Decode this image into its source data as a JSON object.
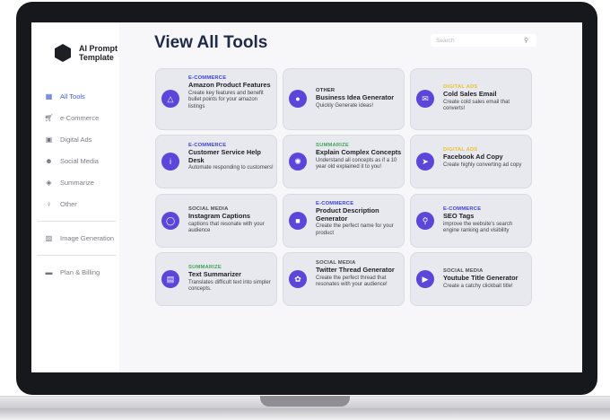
{
  "colors": {
    "accent": "#3b5bdb",
    "icon_bg": "#5b46d9",
    "cat_ecommerce": "#3b3fd6",
    "cat_other": "#2a2c33",
    "cat_digital": "#e6c33a",
    "cat_summarize": "#3fa55b",
    "cat_social": "#4a4d57"
  },
  "sidebar": {
    "logo_line1": "AI Prompt",
    "logo_line2": "Template",
    "items": [
      {
        "label": "All Tools",
        "icon": "grid-icon"
      },
      {
        "label": "e-Commerce",
        "icon": "cart-icon"
      },
      {
        "label": "Digital Ads",
        "icon": "ad-icon"
      },
      {
        "label": "Social Media",
        "icon": "people-icon"
      },
      {
        "label": "Summarize",
        "icon": "box-icon"
      },
      {
        "label": "Other",
        "icon": "bulb-icon"
      },
      {
        "label": "Image Generation",
        "icon": "image-icon"
      },
      {
        "label": "Plan & Billing",
        "icon": "card-icon"
      }
    ]
  },
  "header": {
    "title": "View All Tools",
    "search_placeholder": "Search"
  },
  "cards": [
    {
      "category": "E-COMMERCE",
      "title": "Amazon Product Features",
      "desc": "Create key features and benefit bullet points for your amazon listings",
      "icon": "cart-icon"
    },
    {
      "category": "OTHER",
      "title": "Business Idea Generator",
      "desc": "Quickly Generate ideas!",
      "icon": "bulb-icon"
    },
    {
      "category": "DIGITAL ADS",
      "title": "Cold Sales Email",
      "desc": "Create cold sales email that converts!",
      "icon": "mail-icon"
    },
    {
      "category": "E-COMMERCE",
      "title": "Customer Service Help Desk",
      "desc": "Automate responding to customers!",
      "icon": "info-icon"
    },
    {
      "category": "SUMMARIZE",
      "title": "Explain Complex Concepts",
      "desc": "Understand all concepts as if a 10 year old explained it to you!",
      "icon": "atom-icon"
    },
    {
      "category": "DIGITAL ADS",
      "title": "Facebook Ad Copy",
      "desc": "Create highly converting ad copy",
      "icon": "rocket-icon"
    },
    {
      "category": "SOCIAL MEDIA",
      "title": "Instagram Captions",
      "desc": "captions that resonate with your audience",
      "icon": "instagram-icon"
    },
    {
      "category": "E-COMMERCE",
      "title": "Product Description Generator",
      "desc": "Create the perfect name for your product",
      "icon": "box-icon"
    },
    {
      "category": "E-COMMERCE",
      "title": "SEO Tags",
      "desc": "improve the website's search engine ranking and visibility",
      "icon": "magnify-icon"
    },
    {
      "category": "SUMMARIZE",
      "title": "Text Summarizer",
      "desc": "Translates difficult text into simpler concepts.",
      "icon": "document-icon"
    },
    {
      "category": "SOCIAL MEDIA",
      "title": "Twitter Thread Generator",
      "desc": "Create the perfect thread that resonates with your audience!",
      "icon": "twitter-icon"
    },
    {
      "category": "SOCIAL MEDIA",
      "title": "Youtube Title Generator",
      "desc": "Create a catchy clickbait title!",
      "icon": "youtube-icon"
    }
  ]
}
